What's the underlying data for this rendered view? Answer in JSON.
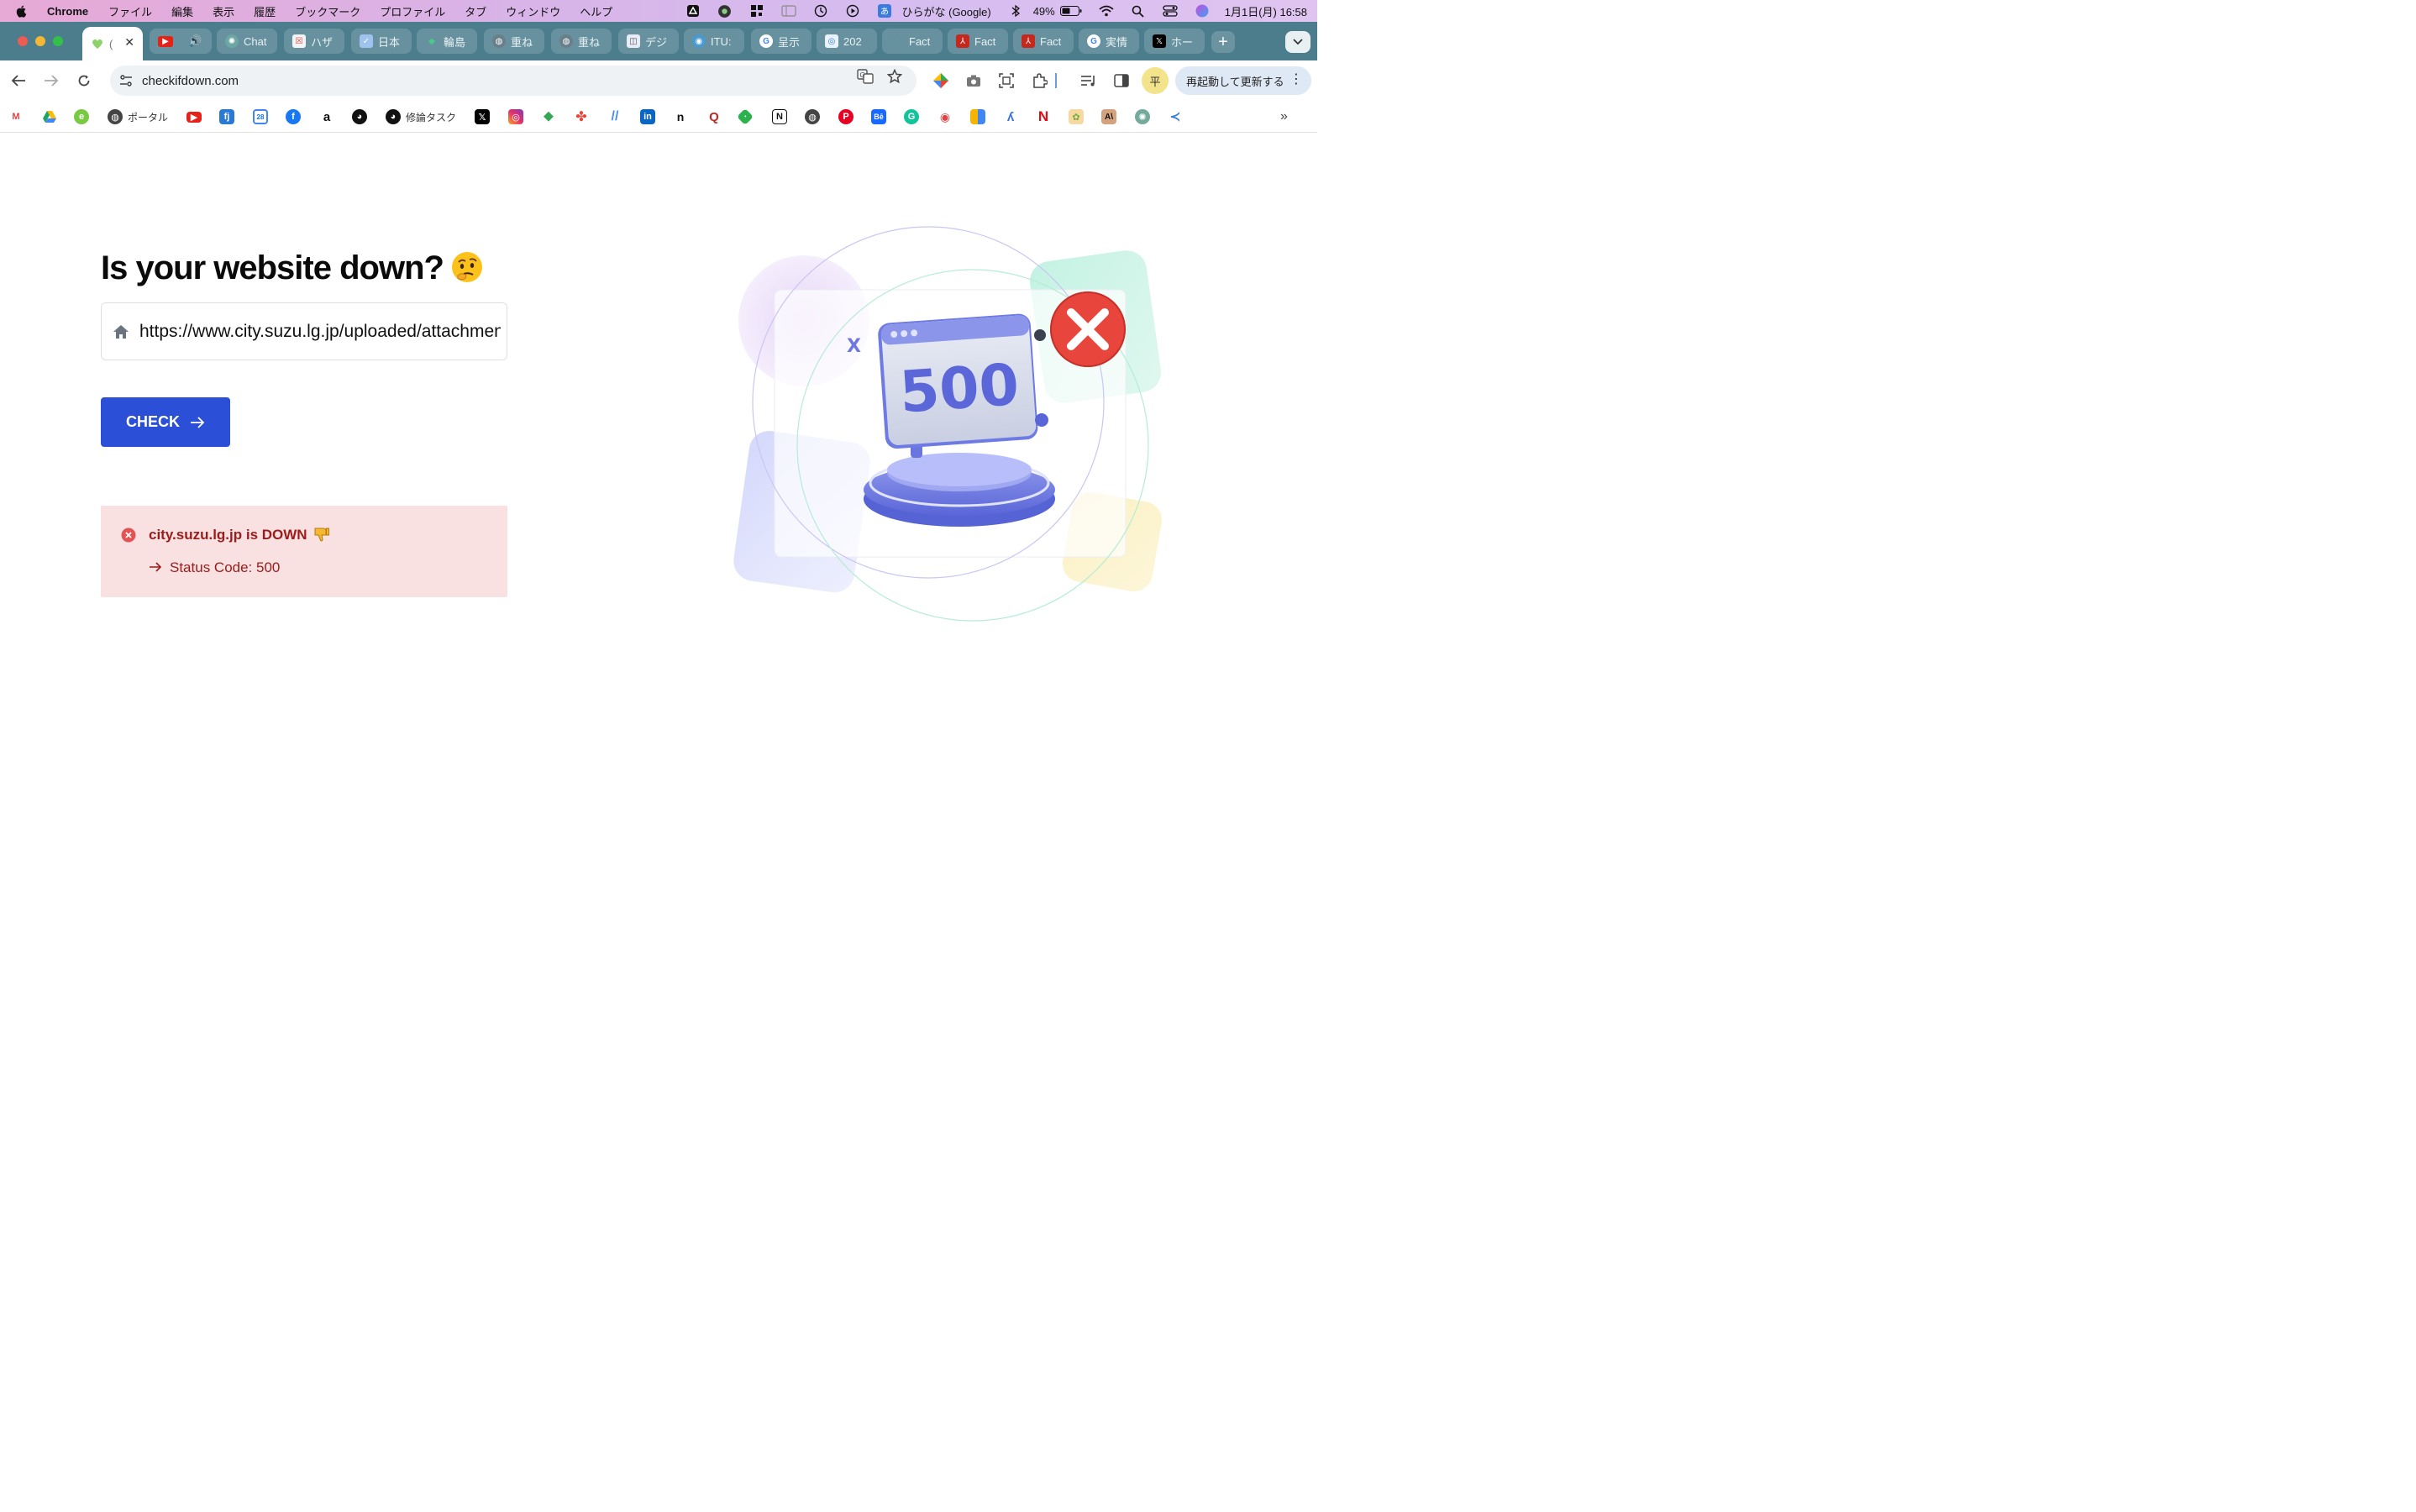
{
  "menubar": {
    "app_name": "Chrome",
    "items": [
      "ファイル",
      "編集",
      "表示",
      "履歴",
      "ブックマーク",
      "プロファイル",
      "タブ",
      "ウィンドウ",
      "ヘルプ"
    ],
    "input_method": "ひらがな (Google)",
    "battery": "49%",
    "datetime": "1月1日(月)  16:58"
  },
  "tabs": [
    {
      "label": "(",
      "icon": "heart-icon",
      "active": true
    },
    {
      "label": "",
      "icon": "youtube-icon"
    },
    {
      "label": "Chat",
      "icon": "chatgpt-icon"
    },
    {
      "label": "ハザ",
      "icon": "map-icon"
    },
    {
      "label": "日本",
      "icon": "doc-icon"
    },
    {
      "label": "輪島",
      "icon": "maps-icon"
    },
    {
      "label": "重ね",
      "icon": "globe-icon"
    },
    {
      "label": "重ね",
      "icon": "globe-icon"
    },
    {
      "label": "デジ",
      "icon": "doc-icon"
    },
    {
      "label": "ITU:",
      "icon": "itu-icon"
    },
    {
      "label": "呈示",
      "icon": "google-icon"
    },
    {
      "label": "202",
      "icon": "site-icon"
    },
    {
      "label": "Fact",
      "icon": "site-icon"
    },
    {
      "label": "Fact",
      "icon": "pdf-icon"
    },
    {
      "label": "Fact",
      "icon": "pdf-icon"
    },
    {
      "label": "実情",
      "icon": "google-icon"
    },
    {
      "label": "ホー",
      "icon": "x-icon"
    }
  ],
  "toolbar": {
    "url": "checkifdown.com",
    "update_label": "再起動して更新する",
    "avatar_letter": "平"
  },
  "bookmarks": [
    {
      "label": "",
      "icon": "gmail-icon"
    },
    {
      "label": "",
      "icon": "drive-icon"
    },
    {
      "label": "",
      "icon": "evernote-icon"
    },
    {
      "label": "ポータル",
      "icon": "globe-icon"
    },
    {
      "label": "",
      "icon": "youtube-icon"
    },
    {
      "label": "",
      "icon": "app-icon"
    },
    {
      "label": "",
      "icon": "calendar-icon"
    },
    {
      "label": "",
      "icon": "facebook-icon"
    },
    {
      "label": "",
      "icon": "amazon-icon"
    },
    {
      "label": "",
      "icon": "github-icon"
    },
    {
      "label": "修論タスク",
      "icon": "github-icon"
    },
    {
      "label": "",
      "icon": "x-icon"
    },
    {
      "label": "",
      "icon": "instagram-icon"
    },
    {
      "label": "",
      "icon": "maps-icon"
    },
    {
      "label": "",
      "icon": "photos-icon"
    },
    {
      "label": "",
      "icon": "app-icon"
    },
    {
      "label": "",
      "icon": "linkedin-icon"
    },
    {
      "label": "",
      "icon": "note-icon"
    },
    {
      "label": "",
      "icon": "quora-icon"
    },
    {
      "label": "",
      "icon": "feedly-icon"
    },
    {
      "label": "",
      "icon": "notion-icon"
    },
    {
      "label": "",
      "icon": "globe-icon"
    },
    {
      "label": "",
      "icon": "pinterest-icon"
    },
    {
      "label": "",
      "icon": "behance-icon"
    },
    {
      "label": "",
      "icon": "grammarly-icon"
    },
    {
      "label": "",
      "icon": "app-icon"
    },
    {
      "label": "",
      "icon": "app-icon"
    },
    {
      "label": "",
      "icon": "app-icon"
    },
    {
      "label": "",
      "icon": "netflix-icon"
    },
    {
      "label": "",
      "icon": "app-icon"
    },
    {
      "label": "",
      "icon": "anthropic-icon"
    },
    {
      "label": "",
      "icon": "chatgpt-icon"
    },
    {
      "label": "",
      "icon": "app-icon"
    }
  ],
  "main": {
    "heading": "Is your website down?",
    "url_value": "https://www.city.suzu.lg.jp/uploaded/attachment/",
    "check_label": "CHECK",
    "result_message": "city.suzu.lg.jp is DOWN",
    "status_line": "Status Code: 500",
    "illustration_code": "500",
    "illustration_x": "X"
  },
  "colors": {
    "accent": "#2b4fd6",
    "alert_bg": "#f9e0e1",
    "alert_text": "#9b1c1c",
    "tab_strip": "#4b7d8c"
  }
}
